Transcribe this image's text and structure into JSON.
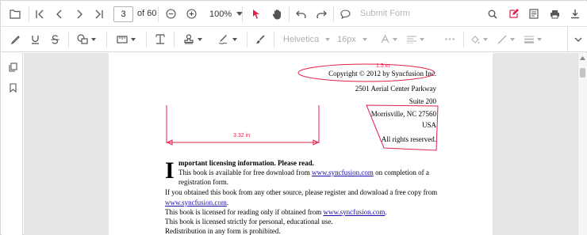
{
  "toolbar": {
    "current_page": "3",
    "page_of": "of 60",
    "zoom": "100%",
    "submit_form": "Submit Form"
  },
  "annotation_toolbar": {
    "font_family": "Helvetica",
    "font_size": "16px"
  },
  "colors": {
    "accent": "#e0214d",
    "link": "#1a0dab",
    "viewer_bg": "#e6e6e6"
  },
  "document": {
    "copyright": "Copyright © 2012 by Syncfusion Inc.",
    "address1": "2501 Aerial Center Parkway",
    "address2": "Suite 200",
    "address3": "Morrisville, NC 27560",
    "address4": "USA",
    "rights": "All rights reserved.",
    "dropcap": "I",
    "heading_rest": "mportant licensing information. Please read.",
    "p1a": "This book is available for free download from ",
    "p1link": "www.syncfusion.com",
    "p1b": " on completion of a",
    "p1c": "registration form.",
    "p2a": "If you obtained this book from any other source, please register and download a free copy from",
    "p2link": "www.syncfusion.com",
    "p2b": ".",
    "p3a": "This book is licensed for reading only if obtained from ",
    "p3link": "www.syncfusion.com",
    "p3b": ".",
    "p4": "This book is licensed strictly for personal, educational use.",
    "p5": "Redistribution in any form is prohibited."
  },
  "annotations": {
    "ellipse_label": "1.5 in",
    "distance_label": "3.32 in"
  }
}
